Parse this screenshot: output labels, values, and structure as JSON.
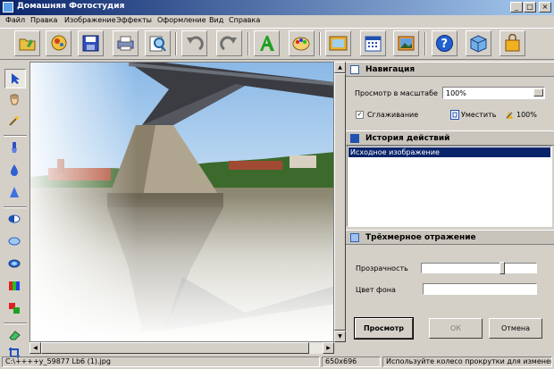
{
  "window": {
    "title": "Домашняя Фотостудия",
    "minimize": "_",
    "maximize": "□",
    "close": "×"
  },
  "menu": [
    "Файл",
    "Правка",
    "Изображение",
    "Эффекты",
    "Оформление",
    "Вид",
    "Справка"
  ],
  "toolbar_icons": [
    "open-folder-icon",
    "magnifier-folder-icon",
    "save-icon",
    "print-icon",
    "preview-zoom-icon",
    "undo-icon",
    "redo-icon",
    "text-icon",
    "palette-icon",
    "frame-icon",
    "calendar-icon",
    "photo-icon",
    "help-icon",
    "box-icon",
    "bag-icon"
  ],
  "tools": [
    "pointer-icon",
    "hand-icon",
    "magic-wand-icon",
    "brush-icon",
    "drop-icon",
    "sharpen-icon",
    "contrast-icon",
    "ellipse-icon",
    "lens-icon",
    "color-levels-icon",
    "clone-icon",
    "eraser-icon",
    "crop-icon"
  ],
  "navigation": {
    "title": "Навигация",
    "zoom_label": "Просмотр в масштабе",
    "zoom_value": "100%",
    "smoothing_label": "Сглаживание",
    "smoothing_checked": true,
    "fit_label": "Уместить",
    "actual_label": "100%"
  },
  "history": {
    "title": "История действий",
    "items": [
      "Исходное изображение"
    ]
  },
  "reflection": {
    "title": "Трёхмерное отражение",
    "transparency_label": "Прозрачность",
    "transparency_value": 0.71,
    "bg_label": "Цвет фона",
    "bg_color": "#ffffff"
  },
  "buttons": {
    "preview": "Просмотр",
    "ok": "ОК",
    "cancel": "Отмена"
  },
  "status": {
    "file": "C:\\++++y_59877 Lb6 (1).jpg",
    "size": "650x696",
    "hint": "Используйте колесо прокрутки для изменения"
  },
  "colors": {
    "titlebar": "#0a246a",
    "selection": "#0a246a",
    "face": "#d4d0c8"
  }
}
